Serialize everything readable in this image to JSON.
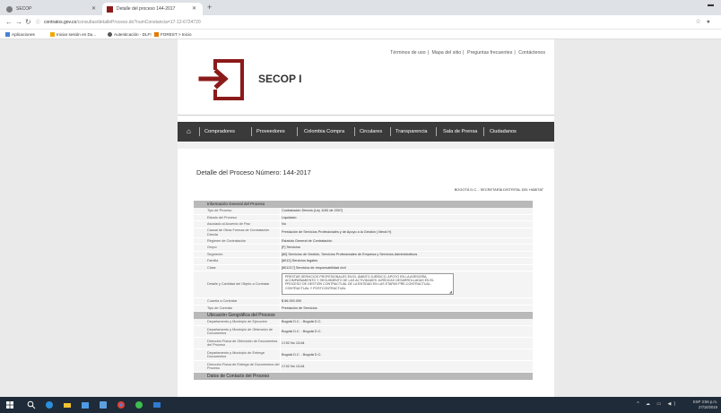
{
  "browser": {
    "tabs": [
      {
        "title": "SECOP",
        "active": false
      },
      {
        "title": "Detalle del proceso 144-2017",
        "active": true
      }
    ],
    "new_tab": "+",
    "url_host": "contratos.gov.co",
    "url_path": "/consultas/detalleProceso.do?numConstancia=17-12-6724720",
    "bookmarks": [
      "Aplicaciones",
      "Iniciar sesión en Du...",
      "Autenticación - DLFI",
      "FOREST > Inicio"
    ]
  },
  "header": {
    "top_links": [
      "Términos de uso",
      "Mapa del sitio",
      "Preguntas frecuentes",
      "Contáctenos"
    ],
    "logo_text": "SECOP I",
    "brand_color": "#8b1a1a"
  },
  "nav": {
    "items": [
      "Compradores",
      "Proveedores",
      "Colombia Compra",
      "Circulares",
      "Transparencia",
      "Sala de Prensa",
      "Ciudadanos"
    ]
  },
  "main": {
    "title": "Detalle del Proceso Número: 144-2017",
    "entity": "BOGOTÁ D.C. - SECRETARÍA DISTRITAL DEL HABITAT",
    "section1": "Información General del Proceso",
    "rows": [
      {
        "label": "Tipo de Proceso",
        "value": "Contratación Directa (Ley 1150 de 2007)"
      },
      {
        "label": "Estado del Proceso",
        "value": "Liquidado"
      },
      {
        "label": "Asociado al Acuerdo de Paz:",
        "value": "No"
      },
      {
        "label": "Causal de Otras Formas de Contratación Directa",
        "value": "Prestación de Servicios Profesionales y de Apoyo a la Gestión ( literal H)"
      },
      {
        "label": "Régimen de Contratación",
        "value": "Estatuto General de Contratación"
      },
      {
        "label": "Grupo",
        "value": "[F] Servicios"
      },
      {
        "label": "Segmento",
        "value": "[80] Servicios de Gestión, Servicios Profesionales de Empresa y Servicios Administrativos"
      },
      {
        "label": "Familia",
        "value": "[8012] Servicios legales"
      },
      {
        "label": "Clase",
        "value": "[801217] Servicios de responsabilidad civil"
      }
    ],
    "object_label": "Detalle y Cantidad del Objeto a Contratar",
    "object_text": "PRESTAR SERVICIOS PROFESIONALES EN EL ÁMBITO JURÍDICO, APOYO EN LA ASESORÍA, ACOMPAÑAMIENTO Y SEGUIMIENTO DE LAS ACTIVIDADES JURÍDICAS DESARROLLADAS EN EL PROCESO DE GESTIÓN CONTRACTUAL DE LA ENTIDAD EN LAS ETAPAS PRE-CONTRACTUAL, CONTRACTUAL Y POSTCONTRACTUAL",
    "rows2": [
      {
        "label": "Cuantía a Contratar",
        "value": "$ 66.000.000"
      },
      {
        "label": "Tipo de Contrato",
        "value": "Prestación de Servicios"
      }
    ],
    "section2": "Ubicación Geográfica del Proceso",
    "rows3": [
      {
        "label": "Departamento y Municipio de Ejecución",
        "value": "Bogotá D.C. : Bogotá D.C."
      },
      {
        "label": "Departamento y Municipio de Obtención de Documentos",
        "value": "Bogotá D.C. : Bogotá D.C."
      },
      {
        "label": "Dirección Física de Obtención de Documentos del Proceso",
        "value": "Cl 52 No 13-64"
      },
      {
        "label": "Departamento y Municipio de Entrega Documentos",
        "value": "Bogotá D.C. : Bogotá D.C."
      },
      {
        "label": "Dirección Física de Entrega de Documentos del Proceso",
        "value": "Cl 52 No 13-64"
      }
    ],
    "section3": "Datos de Contacto del Proceso"
  },
  "taskbar": {
    "time": "3:56 p.m.",
    "date": "27/10/2019",
    "lang": "ESP"
  }
}
